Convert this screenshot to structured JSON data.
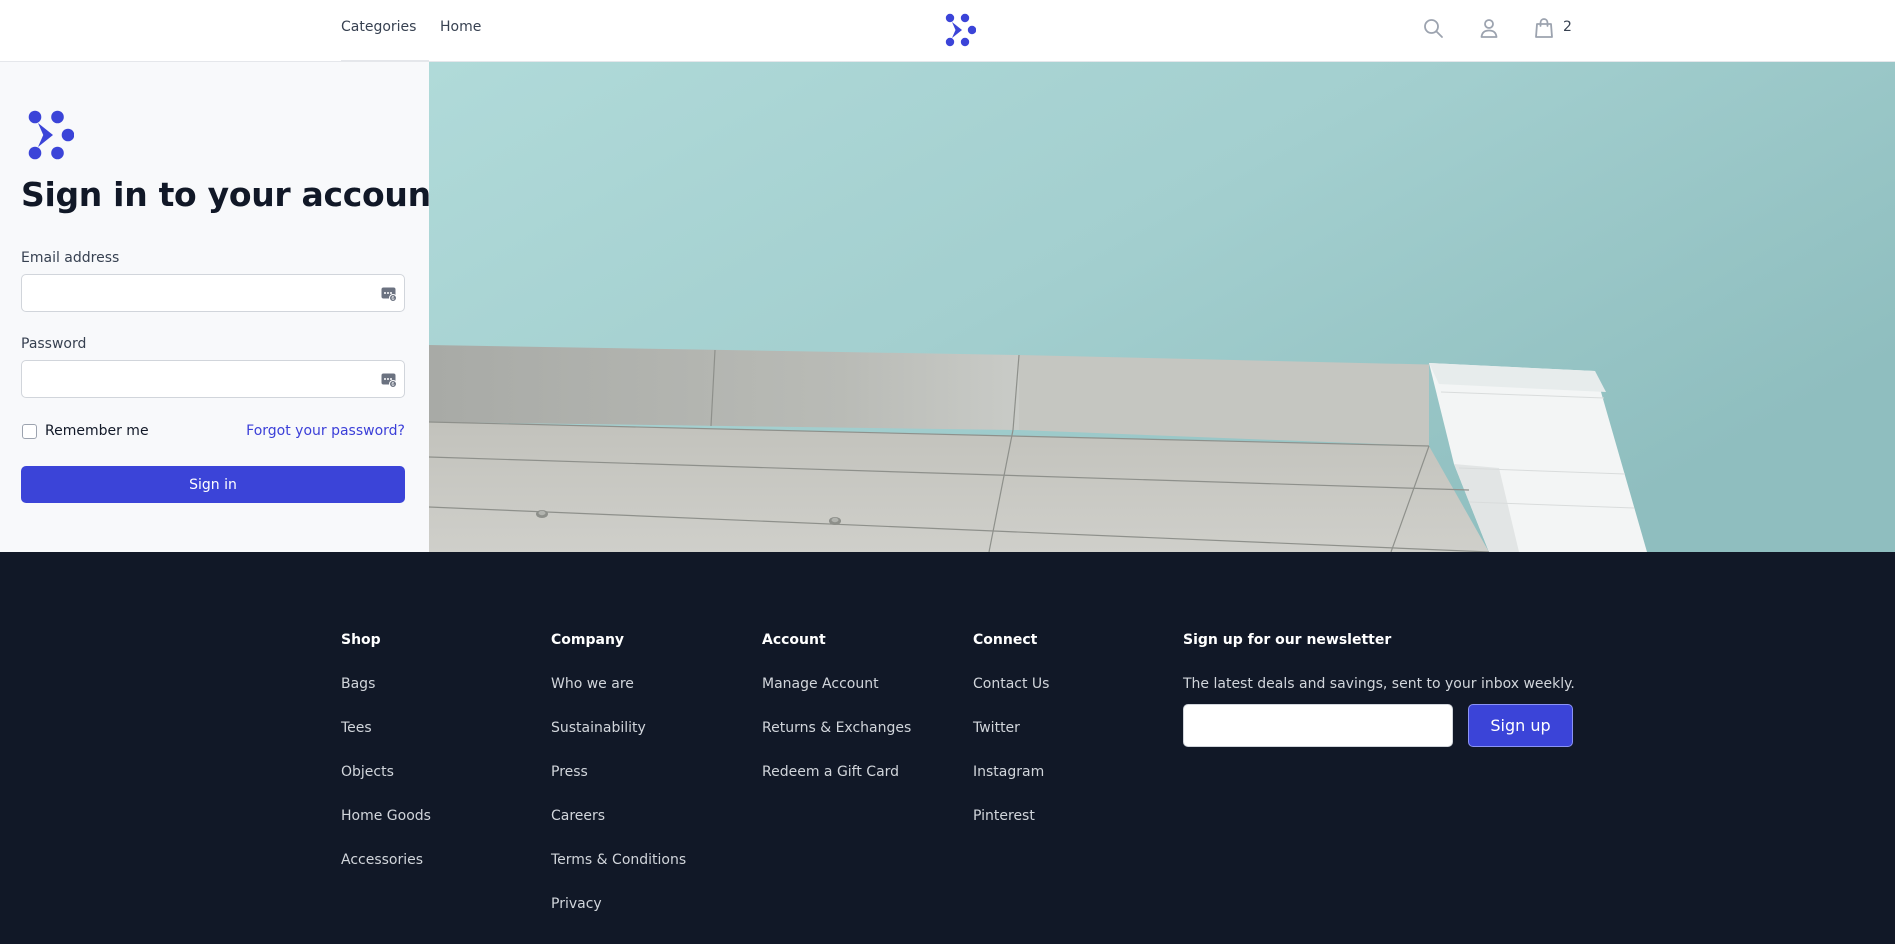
{
  "header": {
    "nav": [
      "Categories",
      "Home"
    ],
    "cart_count": "2",
    "icons": [
      "search-icon",
      "user-icon",
      "shopping-bag-icon"
    ]
  },
  "signin": {
    "title": "Sign in to your account",
    "email_label": "Email address",
    "email_value": "",
    "password_label": "Password",
    "password_value": "",
    "remember_label": "Remember me",
    "remember_checked": false,
    "forgot_label": "Forgot your password?",
    "submit_label": "Sign in"
  },
  "footer": {
    "columns": [
      {
        "title": "Shop",
        "links": [
          "Bags",
          "Tees",
          "Objects",
          "Home Goods",
          "Accessories"
        ]
      },
      {
        "title": "Company",
        "links": [
          "Who we are",
          "Sustainability",
          "Press",
          "Careers",
          "Terms & Conditions",
          "Privacy"
        ]
      },
      {
        "title": "Account",
        "links": [
          "Manage Account",
          "Returns & Exchanges",
          "Redeem a Gift Card"
        ]
      },
      {
        "title": "Connect",
        "links": [
          "Contact Us",
          "Twitter",
          "Instagram",
          "Pinterest"
        ]
      }
    ],
    "newsletter": {
      "title": "Sign up for our newsletter",
      "description": "The latest deals and savings, sent to your inbox weekly.",
      "email_value": "",
      "button_label": "Sign up"
    }
  },
  "colors": {
    "brand": "#3b44d8",
    "footer_bg": "#111827",
    "panel_bg": "#f8f9fb",
    "sky": "#9cc8c9"
  }
}
